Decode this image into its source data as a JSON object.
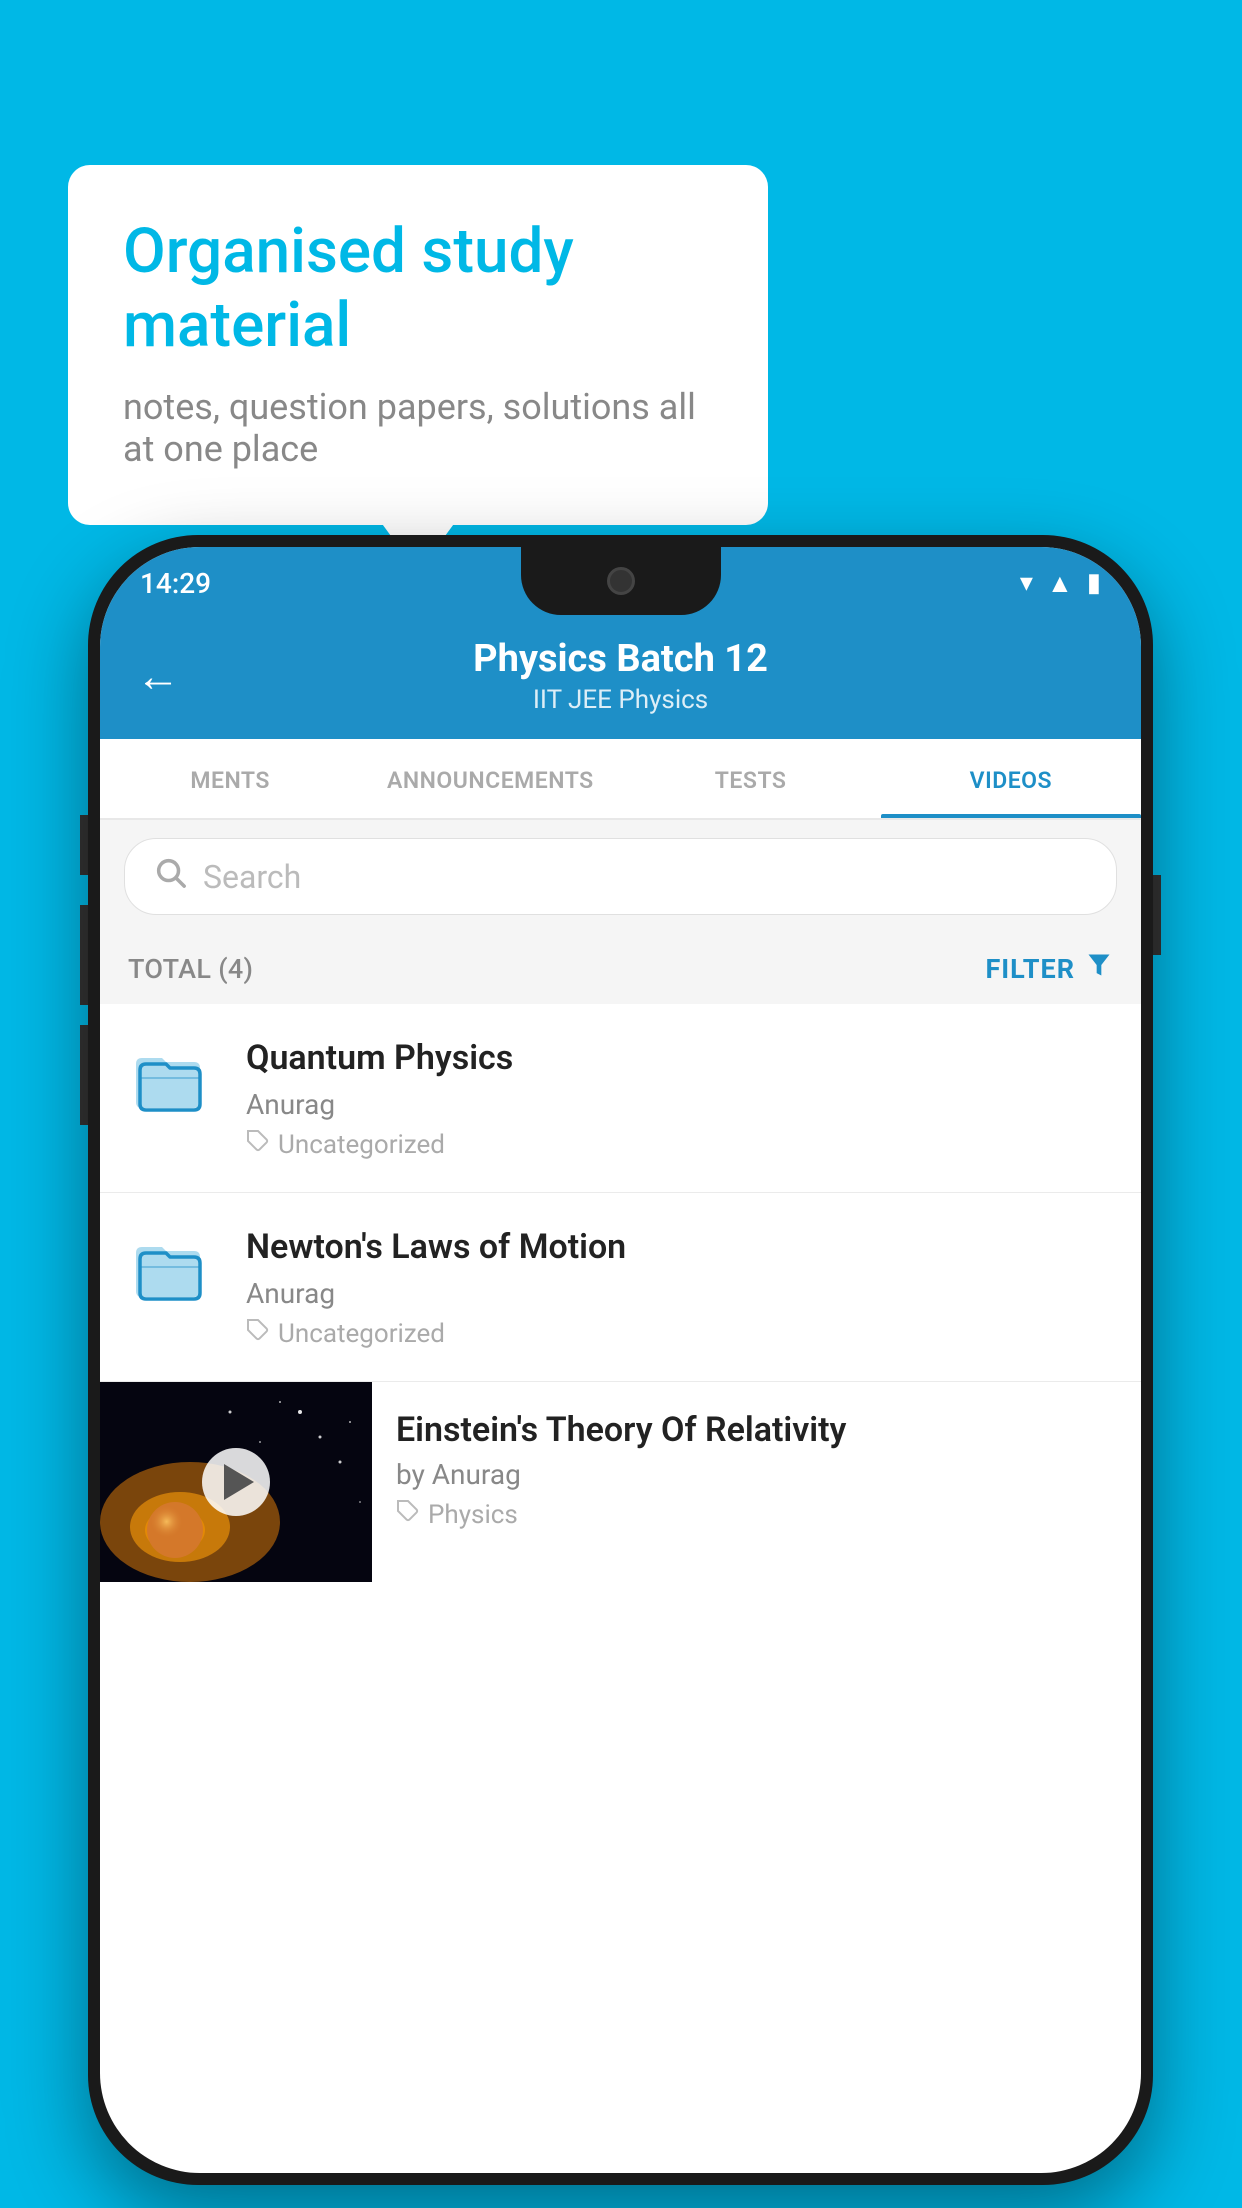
{
  "background": {
    "color": "#00b8e6"
  },
  "bubble": {
    "title": "Organised study material",
    "subtitle": "notes, question papers, solutions all at one place"
  },
  "status_bar": {
    "time": "14:29"
  },
  "header": {
    "title": "Physics Batch 12",
    "subtitle": "IIT JEE   Physics",
    "back_label": "←"
  },
  "tabs": [
    {
      "label": "MENTS",
      "active": false
    },
    {
      "label": "ANNOUNCEMENTS",
      "active": false
    },
    {
      "label": "TESTS",
      "active": false
    },
    {
      "label": "VIDEOS",
      "active": true
    }
  ],
  "search": {
    "placeholder": "Search"
  },
  "filter_row": {
    "total_label": "TOTAL (4)",
    "filter_label": "FILTER"
  },
  "videos": [
    {
      "id": 1,
      "title": "Quantum Physics",
      "author": "Anurag",
      "tag": "Uncategorized",
      "has_thumb": false
    },
    {
      "id": 2,
      "title": "Newton's Laws of Motion",
      "author": "Anurag",
      "tag": "Uncategorized",
      "has_thumb": false
    },
    {
      "id": 3,
      "title": "Einstein's Theory Of Relativity",
      "author": "by Anurag",
      "tag": "Physics",
      "has_thumb": true
    }
  ]
}
